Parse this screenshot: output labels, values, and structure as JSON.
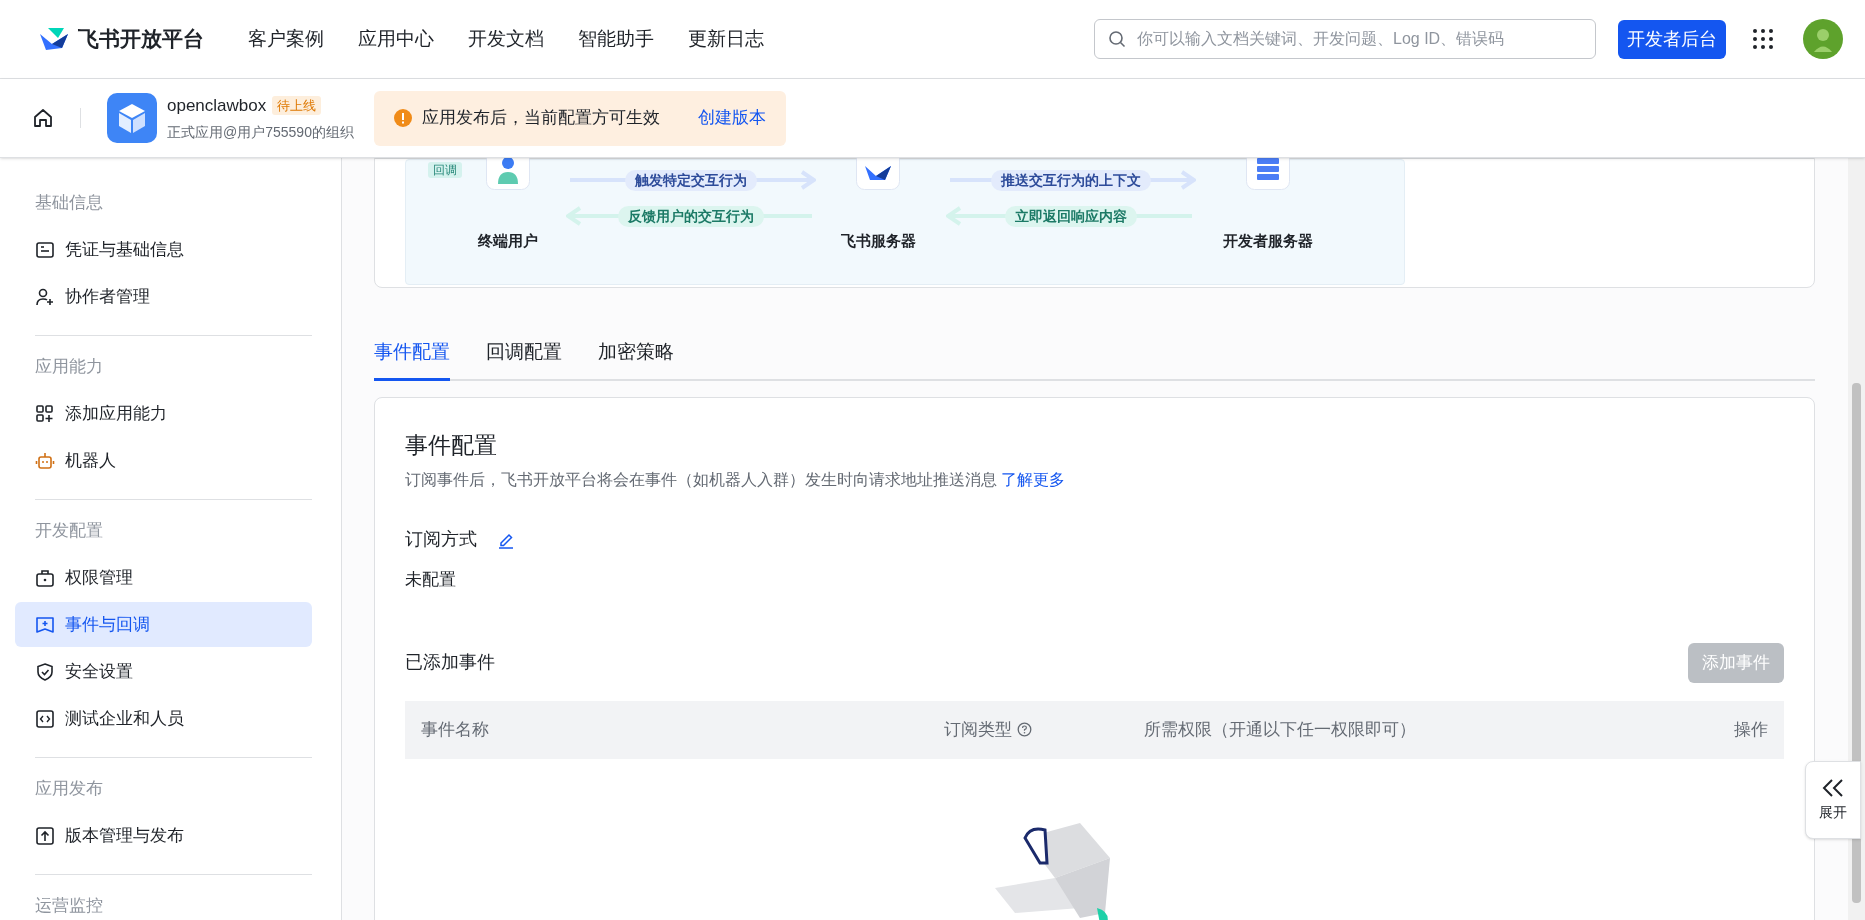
{
  "header": {
    "logo_text": "飞书开放平台",
    "nav": [
      "客户案例",
      "应用中心",
      "开发文档",
      "智能助手",
      "更新日志"
    ],
    "search": {
      "placeholder": "你可以输入文档关键词、开发问题、Log ID、错误码"
    },
    "console_button": "开发者后台"
  },
  "app_bar": {
    "name": "openclawbox",
    "badge": "待上线",
    "org": "正式应用@用户755590的组织",
    "notice": "应用发布后，当前配置方可生效",
    "notice_link": "创建版本"
  },
  "sidebar": {
    "sections": [
      {
        "title": "基础信息",
        "items": [
          {
            "label": "凭证与基础信息",
            "selected": false
          },
          {
            "label": "协作者管理",
            "selected": false
          }
        ]
      },
      {
        "title": "应用能力",
        "items": [
          {
            "label": "添加应用能力",
            "selected": false
          },
          {
            "label": "机器人",
            "selected": false
          }
        ]
      },
      {
        "title": "开发配置",
        "items": [
          {
            "label": "权限管理",
            "selected": false
          },
          {
            "label": "事件与回调",
            "selected": true
          },
          {
            "label": "安全设置",
            "selected": false
          },
          {
            "label": "测试企业和人员",
            "selected": false
          }
        ]
      },
      {
        "title": "应用发布",
        "items": [
          {
            "label": "版本管理与发布",
            "selected": false
          }
        ]
      },
      {
        "title": "运营监控"
      }
    ]
  },
  "diagram": {
    "tag": "回调",
    "nodes": [
      "终端用户",
      "飞书服务器",
      "开发者服务器"
    ],
    "arrows": [
      {
        "label": "触发特定交互行为",
        "kind": "forward"
      },
      {
        "label": "推送交互行为的上下文",
        "kind": "forward"
      },
      {
        "label": "反馈用户的交互行为",
        "kind": "backward"
      },
      {
        "label": "立即返回响应内容",
        "kind": "backward"
      }
    ]
  },
  "tabs": [
    {
      "label": "事件配置",
      "selected": true
    },
    {
      "label": "回调配置",
      "selected": false
    },
    {
      "label": "加密策略",
      "selected": false
    }
  ],
  "event_config": {
    "title": "事件配置",
    "description": "订阅事件后，飞书开放平台将会在事件（如机器人入群）发生时向请求地址推送消息",
    "learn_more": "了解更多",
    "subscription_label": "订阅方式",
    "subscription_value": "未配置",
    "added_title": "已添加事件",
    "add_button": {
      "label": "添加事件",
      "disabled": true
    },
    "columns": [
      {
        "label": "事件名称",
        "help": false
      },
      {
        "label": "订阅类型",
        "help": true
      },
      {
        "label": "所需权限（开通以下任一权限即可）",
        "help": false
      },
      {
        "label": "操作",
        "help": false
      }
    ]
  },
  "expand_button": "展开"
}
